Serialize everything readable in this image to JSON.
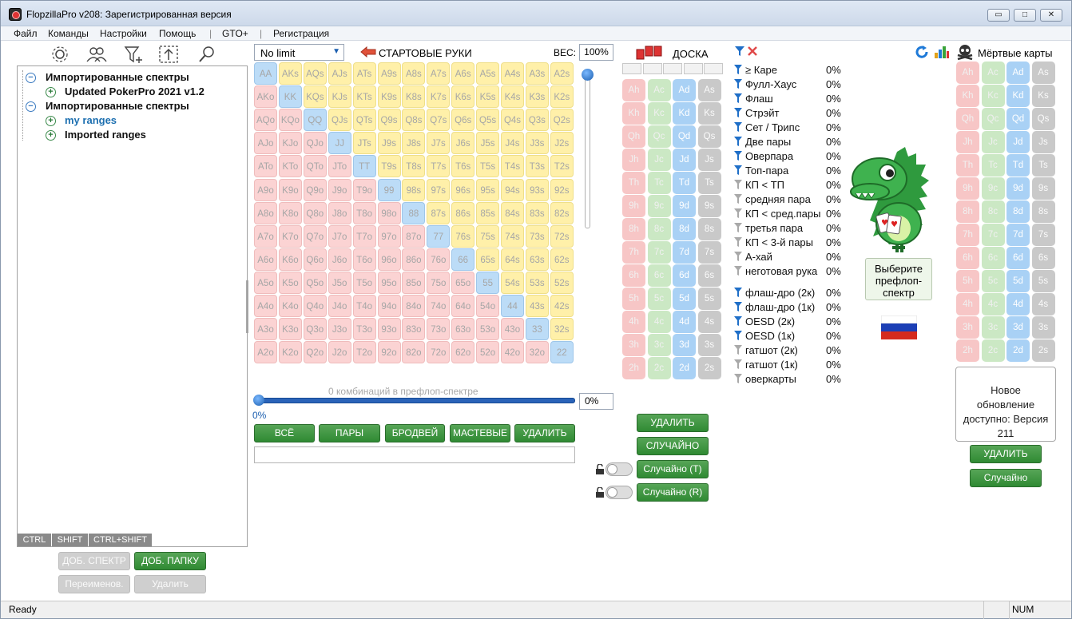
{
  "app": {
    "title": "FlopzillaPro v208: Зарегистрированная версия"
  },
  "window_buttons": {
    "min": "▭",
    "max": "□",
    "close": "✕"
  },
  "menu": [
    "Файл",
    "Команды",
    "Настройки",
    "Помощь",
    "|",
    "GTO+",
    "|",
    "Регистрация"
  ],
  "tree": {
    "items": [
      {
        "label": "Импортированные спектры",
        "level": 0,
        "toggle": "−"
      },
      {
        "label": "Updated PokerPro 2021 v1.2",
        "level": 1,
        "toggle": "+"
      },
      {
        "label": "Импортированные спектры",
        "level": 0,
        "toggle": "−"
      },
      {
        "label": "my ranges",
        "level": 1,
        "toggle": "+",
        "highlight": true
      },
      {
        "label": "Imported ranges",
        "level": 1,
        "toggle": "+"
      }
    ]
  },
  "mod_tabs": [
    "CTRL",
    "SHIFT",
    "CTRL+SHIFT"
  ],
  "left_buttons": {
    "add_range": "ДОБ. СПЕКТР",
    "add_folder": "ДОБ. ПАПКУ",
    "rename": "Переименов.",
    "delete": "Удалить"
  },
  "preflop": {
    "mode": "No limit",
    "header": "СТАРТОВЫЕ РУКИ",
    "weight_label": "ВЕС:",
    "weight_value": "100%",
    "combos_text": "0 комбинаций в префлоп-спектре",
    "slider_value": "0%",
    "slider_pct": "0%"
  },
  "hands": [
    [
      "AA",
      "AKs",
      "AQs",
      "AJs",
      "ATs",
      "A9s",
      "A8s",
      "A7s",
      "A6s",
      "A5s",
      "A4s",
      "A3s",
      "A2s"
    ],
    [
      "AKo",
      "KK",
      "KQs",
      "KJs",
      "KTs",
      "K9s",
      "K8s",
      "K7s",
      "K6s",
      "K5s",
      "K4s",
      "K3s",
      "K2s"
    ],
    [
      "AQo",
      "KQo",
      "QQ",
      "QJs",
      "QTs",
      "Q9s",
      "Q8s",
      "Q7s",
      "Q6s",
      "Q5s",
      "Q4s",
      "Q3s",
      "Q2s"
    ],
    [
      "AJo",
      "KJo",
      "QJo",
      "JJ",
      "JTs",
      "J9s",
      "J8s",
      "J7s",
      "J6s",
      "J5s",
      "J4s",
      "J3s",
      "J2s"
    ],
    [
      "ATo",
      "KTo",
      "QTo",
      "JTo",
      "TT",
      "T9s",
      "T8s",
      "T7s",
      "T6s",
      "T5s",
      "T4s",
      "T3s",
      "T2s"
    ],
    [
      "A9o",
      "K9o",
      "Q9o",
      "J9o",
      "T9o",
      "99",
      "98s",
      "97s",
      "96s",
      "95s",
      "94s",
      "93s",
      "92s"
    ],
    [
      "A8o",
      "K8o",
      "Q8o",
      "J8o",
      "T8o",
      "98o",
      "88",
      "87s",
      "86s",
      "85s",
      "84s",
      "83s",
      "82s"
    ],
    [
      "A7o",
      "K7o",
      "Q7o",
      "J7o",
      "T7o",
      "97o",
      "87o",
      "77",
      "76s",
      "75s",
      "74s",
      "73s",
      "72s"
    ],
    [
      "A6o",
      "K6o",
      "Q6o",
      "J6o",
      "T6o",
      "96o",
      "86o",
      "76o",
      "66",
      "65s",
      "64s",
      "63s",
      "62s"
    ],
    [
      "A5o",
      "K5o",
      "Q5o",
      "J5o",
      "T5o",
      "95o",
      "85o",
      "75o",
      "65o",
      "55",
      "54s",
      "53s",
      "52s"
    ],
    [
      "A4o",
      "K4o",
      "Q4o",
      "J4o",
      "T4o",
      "94o",
      "84o",
      "74o",
      "64o",
      "54o",
      "44",
      "43s",
      "42s"
    ],
    [
      "A3o",
      "K3o",
      "Q3o",
      "J3o",
      "T3o",
      "93o",
      "83o",
      "73o",
      "63o",
      "53o",
      "43o",
      "33",
      "32s"
    ],
    [
      "A2o",
      "K2o",
      "Q2o",
      "J2o",
      "T2o",
      "92o",
      "82o",
      "72o",
      "62o",
      "52o",
      "42o",
      "32o",
      "22"
    ]
  ],
  "preflop_buttons": [
    "ВСЁ",
    "ПАРЫ",
    "БРОДВЕЙ",
    "МАСТЕВЫЕ",
    "УДАЛИТЬ"
  ],
  "board": {
    "header": "ДОСКА",
    "ranks": [
      "A",
      "K",
      "Q",
      "J",
      "T",
      "9",
      "8",
      "7",
      "6",
      "5",
      "4",
      "3",
      "2"
    ],
    "suits": [
      "h",
      "c",
      "d",
      "s"
    ],
    "buttons": {
      "delete": "УДАЛИТЬ",
      "random": "СЛУЧАЙНО",
      "random_t": "Случайно (T)",
      "random_r": "Случайно (R)"
    }
  },
  "stats": {
    "items": [
      {
        "label": "≥ Каре",
        "value": "0%",
        "filter": "blue"
      },
      {
        "label": "Фулл-Хаус",
        "value": "0%",
        "filter": "blue"
      },
      {
        "label": "Флаш",
        "value": "0%",
        "filter": "blue"
      },
      {
        "label": "Стрэйт",
        "value": "0%",
        "filter": "blue"
      },
      {
        "label": "Сет / Трипс",
        "value": "0%",
        "filter": "blue"
      },
      {
        "label": "Две пары",
        "value": "0%",
        "filter": "blue"
      },
      {
        "label": "Оверпара",
        "value": "0%",
        "filter": "blue"
      },
      {
        "label": "Топ-пара",
        "value": "0%",
        "filter": "blue"
      },
      {
        "label": "КП < ТП",
        "value": "0%",
        "filter": "gray"
      },
      {
        "label": "средняя пара",
        "value": "0%",
        "filter": "gray"
      },
      {
        "label": "КП < сред.пары",
        "value": "0%",
        "filter": "gray"
      },
      {
        "label": "третья пара",
        "value": "0%",
        "filter": "gray"
      },
      {
        "label": "КП < 3-й пары",
        "value": "0%",
        "filter": "gray"
      },
      {
        "label": "А-хай",
        "value": "0%",
        "filter": "gray"
      },
      {
        "label": "неготовая рука",
        "value": "0%",
        "filter": "gray"
      },
      {
        "label": "флаш-дро (2к)",
        "value": "0%",
        "filter": "blue"
      },
      {
        "label": "флаш-дро (1к)",
        "value": "0%",
        "filter": "blue"
      },
      {
        "label": "OESD (2к)",
        "value": "0%",
        "filter": "blue"
      },
      {
        "label": "OESD (1к)",
        "value": "0%",
        "filter": "blue"
      },
      {
        "label": "гатшот (2к)",
        "value": "0%",
        "filter": "gray"
      },
      {
        "label": "гатшот (1к)",
        "value": "0%",
        "filter": "gray"
      },
      {
        "label": "оверкарты",
        "value": "0%",
        "filter": "gray"
      }
    ]
  },
  "mascot": {
    "caption": "Выберите префлоп-спектр"
  },
  "dead_cards": {
    "header": "Мёртвые карты",
    "delete": "УДАЛИТЬ",
    "random": "Случайно"
  },
  "update": {
    "text": "Новое обновление доступно: Версия 211"
  },
  "status": {
    "left": "Ready",
    "right": "NUM"
  },
  "colors": {
    "green_button": "#3a943d",
    "suited": "#fff0a9",
    "offsuit": "#fbd3d3",
    "pair": "#bcdcf7",
    "hearts": "#f7c6c6",
    "clubs": "#cbe8c4",
    "diamonds": "#a9d1f5",
    "spades": "#c9c9c9",
    "filter_blue": "#1f6fc8"
  }
}
